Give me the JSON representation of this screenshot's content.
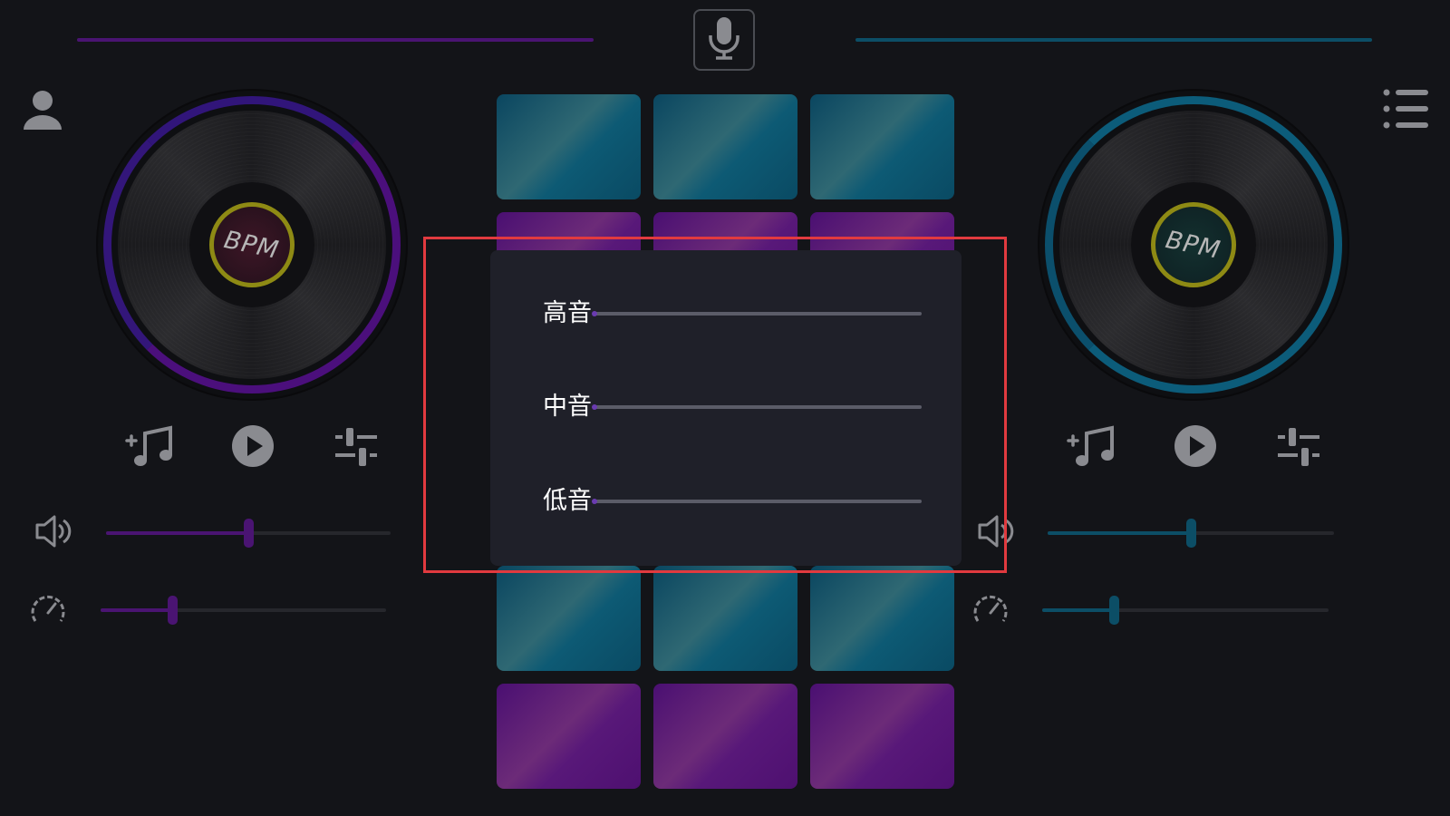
{
  "eq_dialog": {
    "rows": [
      {
        "label": "高音",
        "level": 0
      },
      {
        "label": "中音",
        "level": 0
      },
      {
        "label": "低音",
        "level": 0
      }
    ]
  },
  "deck_left": {
    "bpm_label": "BPM",
    "volume_level": 0.5,
    "pitch_level": 0.25,
    "accent": "#4a1472"
  },
  "deck_right": {
    "bpm_label": "BPM",
    "volume_level": 0.5,
    "pitch_level": 0.25,
    "accent": "#0c4e66"
  },
  "icons": {
    "top": "microphone-icon",
    "left_corner": "user-profile-icon",
    "right_corner": "menu-list-icon",
    "deck_controls": [
      "add-music-icon",
      "play-icon",
      "equalizer-settings-icon"
    ],
    "volume": "speaker-volume-icon",
    "pitch": "speedometer-icon"
  },
  "pads": {
    "colors": [
      "teal",
      "violet",
      "teal",
      "violet"
    ]
  },
  "colors": {
    "highlight": "#e13a3f",
    "bpm_ring": "#8e8a14"
  }
}
